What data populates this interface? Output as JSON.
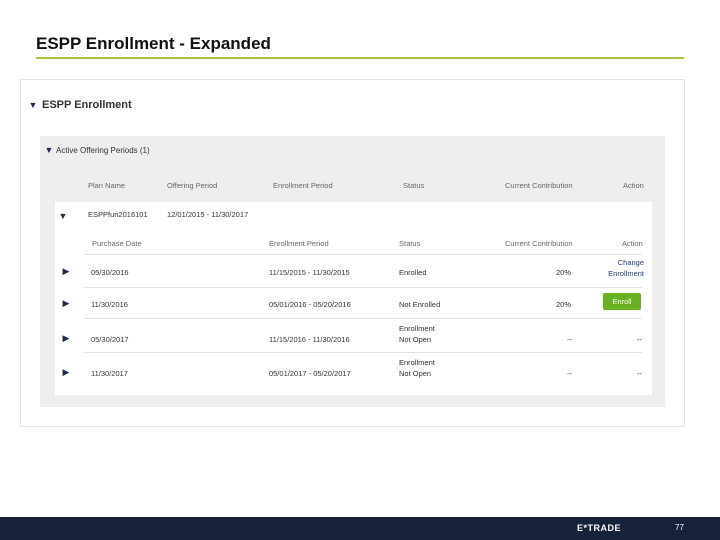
{
  "slide": {
    "title": "ESPP Enrollment - Expanded",
    "page_number": "77",
    "footer_logo": "E*TRADE"
  },
  "colors": {
    "accent_rule": "#a9c23f",
    "enroll_button": "#6ab023",
    "footer": "#16213b"
  },
  "espp": {
    "section_title": "ESPP Enrollment",
    "periods_title": "Active Offering Periods (1)",
    "columns": [
      "Plan Name",
      "Offering Period",
      "Enrollment Period",
      "Status",
      "Current Contribution",
      "Action"
    ],
    "plan": {
      "name": "ESPPfun2016101",
      "offering_period": "12/01/2015 - 11/30/2017"
    },
    "sub_columns": [
      "Purchase Date",
      "Enrollment Period",
      "Status",
      "Current Contribution",
      "Action"
    ],
    "rows": [
      {
        "purchase_date": "05/30/2016",
        "enrollment_period": "11/15/2015 - 11/30/2015",
        "status": "Enrolled",
        "contribution": "20%",
        "action_line1": "Change",
        "action_line2": "Enrollment"
      },
      {
        "purchase_date": "11/30/2016",
        "enrollment_period": "05/01/2016 - 05/20/2016",
        "status": "Not Enrolled",
        "contribution": "20%",
        "action": "Enroll"
      },
      {
        "purchase_date": "05/30/2017",
        "enrollment_period": "11/15/2016 - 11/30/2016",
        "status_line1": "Enrollment",
        "status_line2": "Not Open",
        "contribution": "--",
        "action": "--"
      },
      {
        "purchase_date": "11/30/2017",
        "enrollment_period": "05/01/2017 - 05/20/2017",
        "status_line1": "Enrollment",
        "status_line2": "Not Open",
        "contribution": "--",
        "action": "--"
      }
    ]
  },
  "icons": {
    "expand": "chevron-down-icon",
    "collapsed": "chevron-right-icon"
  }
}
